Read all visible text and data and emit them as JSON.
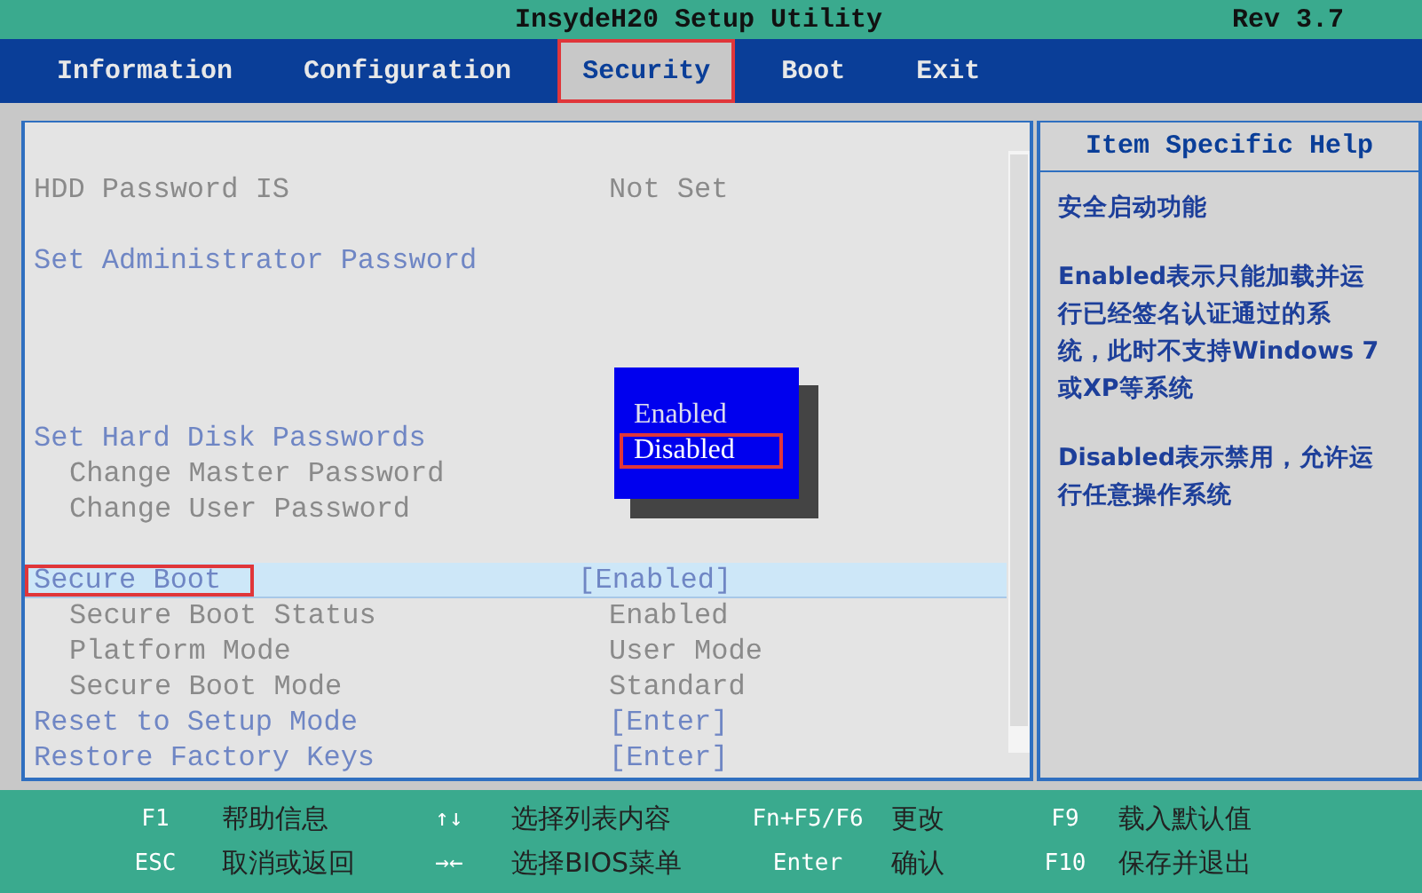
{
  "title_bar": {
    "title": "InsydeH20 Setup Utility",
    "revision": "Rev 3.7"
  },
  "tabs": [
    {
      "label": "Information",
      "selected": false,
      "annotated": false
    },
    {
      "label": "Configuration",
      "selected": false,
      "annotated": false
    },
    {
      "label": "Security",
      "selected": true,
      "annotated": true
    },
    {
      "label": "Boot",
      "selected": false,
      "annotated": false
    },
    {
      "label": "Exit",
      "selected": false,
      "annotated": false
    }
  ],
  "settings": [
    {
      "label": "HDD Password IS",
      "value": "Not Set",
      "kind": "info",
      "selected": false,
      "annotated": false
    },
    {
      "label": "Set Administrator Password",
      "kind": "action",
      "selected": false,
      "annotated": false
    },
    {
      "label": "Set Hard Disk Passwords",
      "kind": "action",
      "selected": false,
      "annotated": false,
      "children": [
        {
          "label": "Change Master Password",
          "kind": "info"
        },
        {
          "label": "Change User Password",
          "kind": "info"
        }
      ]
    },
    {
      "label": "Secure Boot",
      "value": "[Enabled]",
      "kind": "action",
      "selected": true,
      "annotated": true,
      "children": [
        {
          "label": "Secure Boot Status",
          "value": "Enabled",
          "kind": "info"
        },
        {
          "label": "Platform Mode",
          "value": "User Mode",
          "kind": "info"
        },
        {
          "label": "Secure Boot Mode",
          "value": "Standard",
          "kind": "info"
        }
      ]
    },
    {
      "label": "Reset to Setup Mode",
      "value": "[Enter]",
      "kind": "action",
      "selected": false,
      "annotated": false
    },
    {
      "label": "Restore Factory Keys",
      "value": "[Enter]",
      "kind": "action",
      "selected": false,
      "annotated": false
    }
  ],
  "popup": {
    "options": [
      {
        "label": "Enabled",
        "selected": false,
        "annotated": false
      },
      {
        "label": "Disabled",
        "selected": true,
        "annotated": true
      }
    ]
  },
  "help": {
    "title": "Item Specific Help",
    "paragraphs": [
      "安全启动功能",
      "Enabled表示只能加载并运行已经签名认证通过的系统，此时不支持Windows 7或XP等系统",
      "Disabled表示禁用，允许运行任意操作系统"
    ]
  },
  "key_hints": [
    {
      "key": "F1",
      "action": "帮助信息"
    },
    {
      "key": "↑↓",
      "action": "选择列表内容"
    },
    {
      "key": "Fn+F5/F6",
      "action": "更改"
    },
    {
      "key": "F9",
      "action": "载入默认值"
    },
    {
      "key": "ESC",
      "action": "取消或返回"
    },
    {
      "key": "→←",
      "action": "选择BIOS菜单"
    },
    {
      "key": "Enter",
      "action": "确认"
    },
    {
      "key": "F10",
      "action": "保存并退出"
    }
  ]
}
